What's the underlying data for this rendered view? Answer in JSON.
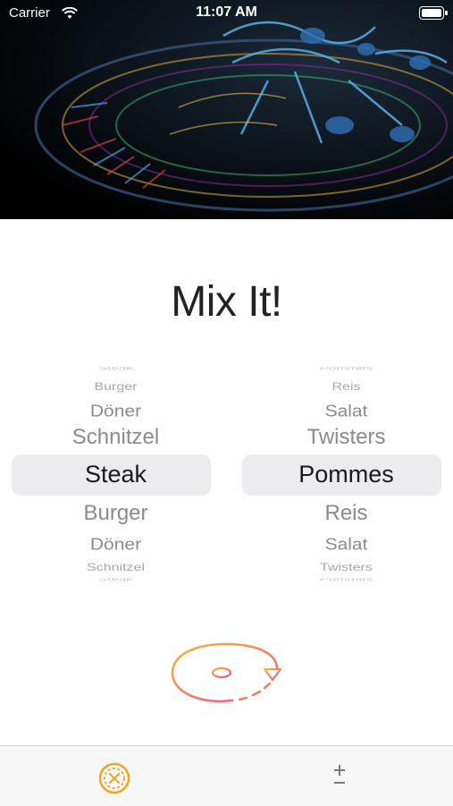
{
  "status_bar": {
    "carrier": "Carrier",
    "time": "11:07 AM"
  },
  "header": {
    "title": "Mix It!"
  },
  "picker_left": {
    "rows": [
      "Steak",
      "Burger",
      "Döner",
      "Schnitzel",
      "Steak",
      "Burger",
      "Döner",
      "Schnitzel",
      "Steak"
    ],
    "selected": "Steak"
  },
  "picker_right": {
    "rows": [
      "Pommes",
      "Reis",
      "Salat",
      "Twisters",
      "Pommes",
      "Reis",
      "Salat",
      "Twisters",
      "Pommes"
    ],
    "selected": "Pommes"
  },
  "tab_bar": {
    "items": [
      {
        "icon": "roulette-chip-icon",
        "selected": true
      },
      {
        "icon": "plus-minus-icon",
        "selected": false
      }
    ],
    "accent": "#f0a51e"
  },
  "colors": {
    "spin_gradient_start": "#f7b733",
    "spin_gradient_end": "#fc4a8a"
  }
}
